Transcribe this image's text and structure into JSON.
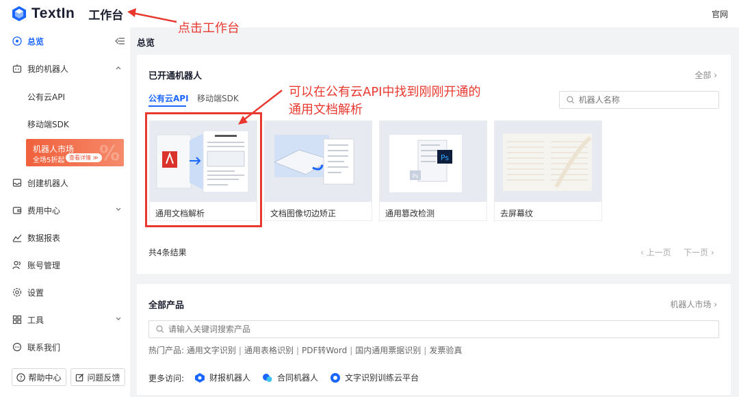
{
  "header": {
    "logo_text": "TextIn",
    "app_title": "工作台",
    "link_official": "官网"
  },
  "sidebar": {
    "overview": "总览",
    "my_robots": "我的机器人",
    "sub_public_api": "公有云API",
    "sub_mobile_sdk": "移动端SDK",
    "promo_title": "机器人市场",
    "promo_sub": "全场5折起",
    "promo_badge": "查看详情 ≫",
    "create_robot": "创建机器人",
    "billing": "费用中心",
    "data_report": "数据报表",
    "account": "账号管理",
    "settings": "设置",
    "tools": "工具",
    "contact": "联系我们",
    "help_center": "帮助中心",
    "feedback": "问题反馈"
  },
  "main": {
    "page_title": "总览",
    "opened_robots": {
      "title": "已开通机器人",
      "all_link": "全部 ›",
      "tabs": [
        "公有云API",
        "移动端SDK"
      ],
      "search_placeholder": "机器人名称",
      "robots": [
        {
          "label": "通用文档解析"
        },
        {
          "label": "文档图像切边矫正"
        },
        {
          "label": "通用篡改检测"
        },
        {
          "label": "去屏幕纹"
        }
      ],
      "result_count": "共4条结果",
      "prev_page": "‹ 上一页",
      "next_page": "下一页 ›"
    },
    "all_products": {
      "title": "全部产品",
      "market_link": "机器人市场 ›",
      "search_placeholder": "请输入关键词搜索产品",
      "hot_label": "热门产品:",
      "hot_items": [
        "通用文字识别",
        "通用表格识别",
        "PDF转Word",
        "国内通用票据识别",
        "发票验真"
      ],
      "more_label": "更多访问:",
      "more_items": [
        "财报机器人",
        "合同机器人",
        "文字识别训练云平台"
      ]
    }
  },
  "annotations": {
    "click_workbench": "点击工作台",
    "find_hint_line1": "可以在公有云API中找到刚刚开通的",
    "find_hint_line2": "通用文档解析"
  },
  "colors": {
    "accent": "#1a66ff",
    "annotation": "#e8382f",
    "promo": "#f0603c"
  }
}
